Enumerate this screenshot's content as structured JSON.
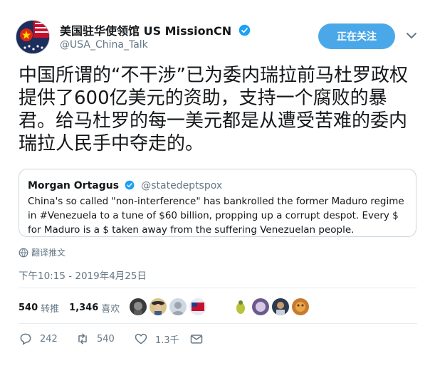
{
  "header": {
    "display_name": "美国驻华使领馆 US MissionCN",
    "handle": "@USA_China_Talk",
    "follow_label": "正在关注"
  },
  "tweet": {
    "text": "中国所谓的“不干涉”已为委内瑞拉前马杜罗政权提供了600亿美元的资助，支持一个腐败的暴君。给马杜罗的每一美元都是从遭受苦难的委内瑞拉人民手中夺走的。"
  },
  "quote": {
    "name": "Morgan Ortagus",
    "handle": "@statedeptspox",
    "text": "China's so called \"non-interference\" has bankrolled the former Maduro regime in #Venezuela to a tune of $60 billion, propping up a corrupt despot. Every $ for Maduro is a $ taken away from the suffering Venezuelan people."
  },
  "translate_label": "翻译推文",
  "timestamp": "下午10:15 - 2019年4月25日",
  "stats": {
    "retweets": "540",
    "retweets_label": "转推",
    "likes": "1,346",
    "likes_label": "喜欢"
  },
  "actions": {
    "replies": "242",
    "retweets": "540",
    "likes": "1.3千"
  },
  "colors": {
    "accent": "#1da1f2",
    "follow_button": "#4aa8e8",
    "muted": "#657786"
  }
}
